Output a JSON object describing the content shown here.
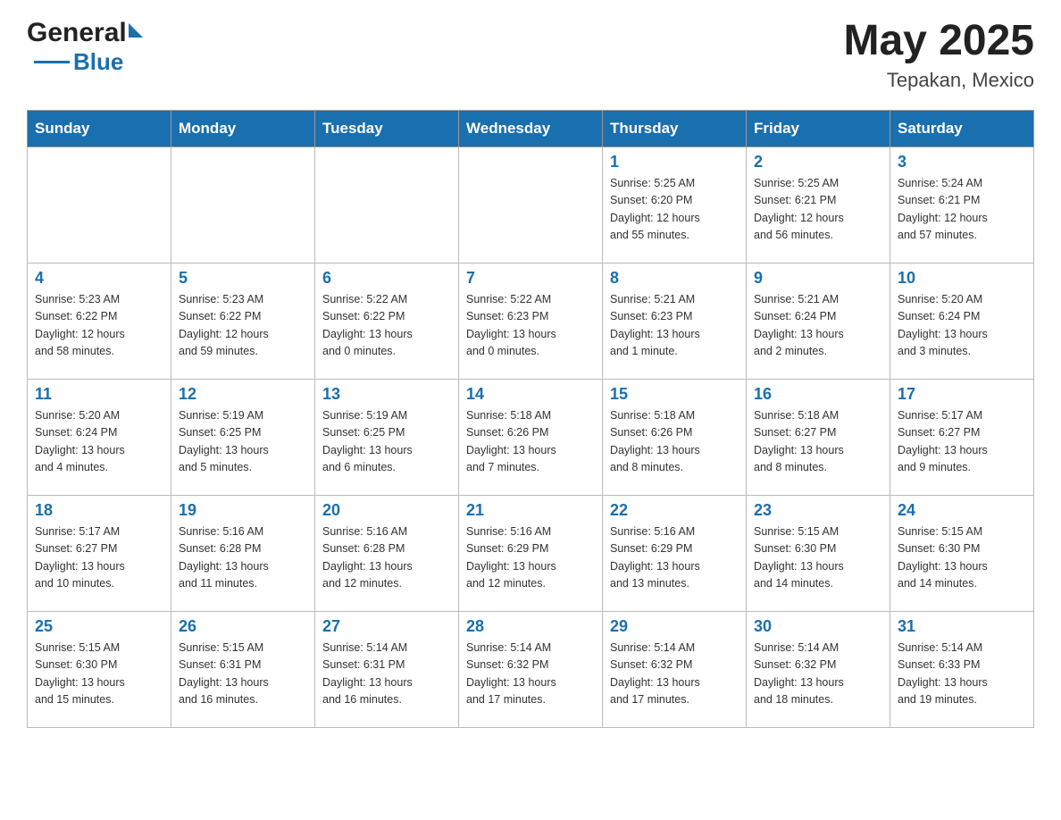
{
  "header": {
    "logo_general": "General",
    "logo_blue": "Blue",
    "month_year": "May 2025",
    "location": "Tepakan, Mexico"
  },
  "days_of_week": [
    "Sunday",
    "Monday",
    "Tuesday",
    "Wednesday",
    "Thursday",
    "Friday",
    "Saturday"
  ],
  "weeks": [
    [
      {
        "day": "",
        "info": ""
      },
      {
        "day": "",
        "info": ""
      },
      {
        "day": "",
        "info": ""
      },
      {
        "day": "",
        "info": ""
      },
      {
        "day": "1",
        "info": "Sunrise: 5:25 AM\nSunset: 6:20 PM\nDaylight: 12 hours\nand 55 minutes."
      },
      {
        "day": "2",
        "info": "Sunrise: 5:25 AM\nSunset: 6:21 PM\nDaylight: 12 hours\nand 56 minutes."
      },
      {
        "day": "3",
        "info": "Sunrise: 5:24 AM\nSunset: 6:21 PM\nDaylight: 12 hours\nand 57 minutes."
      }
    ],
    [
      {
        "day": "4",
        "info": "Sunrise: 5:23 AM\nSunset: 6:22 PM\nDaylight: 12 hours\nand 58 minutes."
      },
      {
        "day": "5",
        "info": "Sunrise: 5:23 AM\nSunset: 6:22 PM\nDaylight: 12 hours\nand 59 minutes."
      },
      {
        "day": "6",
        "info": "Sunrise: 5:22 AM\nSunset: 6:22 PM\nDaylight: 13 hours\nand 0 minutes."
      },
      {
        "day": "7",
        "info": "Sunrise: 5:22 AM\nSunset: 6:23 PM\nDaylight: 13 hours\nand 0 minutes."
      },
      {
        "day": "8",
        "info": "Sunrise: 5:21 AM\nSunset: 6:23 PM\nDaylight: 13 hours\nand 1 minute."
      },
      {
        "day": "9",
        "info": "Sunrise: 5:21 AM\nSunset: 6:24 PM\nDaylight: 13 hours\nand 2 minutes."
      },
      {
        "day": "10",
        "info": "Sunrise: 5:20 AM\nSunset: 6:24 PM\nDaylight: 13 hours\nand 3 minutes."
      }
    ],
    [
      {
        "day": "11",
        "info": "Sunrise: 5:20 AM\nSunset: 6:24 PM\nDaylight: 13 hours\nand 4 minutes."
      },
      {
        "day": "12",
        "info": "Sunrise: 5:19 AM\nSunset: 6:25 PM\nDaylight: 13 hours\nand 5 minutes."
      },
      {
        "day": "13",
        "info": "Sunrise: 5:19 AM\nSunset: 6:25 PM\nDaylight: 13 hours\nand 6 minutes."
      },
      {
        "day": "14",
        "info": "Sunrise: 5:18 AM\nSunset: 6:26 PM\nDaylight: 13 hours\nand 7 minutes."
      },
      {
        "day": "15",
        "info": "Sunrise: 5:18 AM\nSunset: 6:26 PM\nDaylight: 13 hours\nand 8 minutes."
      },
      {
        "day": "16",
        "info": "Sunrise: 5:18 AM\nSunset: 6:27 PM\nDaylight: 13 hours\nand 8 minutes."
      },
      {
        "day": "17",
        "info": "Sunrise: 5:17 AM\nSunset: 6:27 PM\nDaylight: 13 hours\nand 9 minutes."
      }
    ],
    [
      {
        "day": "18",
        "info": "Sunrise: 5:17 AM\nSunset: 6:27 PM\nDaylight: 13 hours\nand 10 minutes."
      },
      {
        "day": "19",
        "info": "Sunrise: 5:16 AM\nSunset: 6:28 PM\nDaylight: 13 hours\nand 11 minutes."
      },
      {
        "day": "20",
        "info": "Sunrise: 5:16 AM\nSunset: 6:28 PM\nDaylight: 13 hours\nand 12 minutes."
      },
      {
        "day": "21",
        "info": "Sunrise: 5:16 AM\nSunset: 6:29 PM\nDaylight: 13 hours\nand 12 minutes."
      },
      {
        "day": "22",
        "info": "Sunrise: 5:16 AM\nSunset: 6:29 PM\nDaylight: 13 hours\nand 13 minutes."
      },
      {
        "day": "23",
        "info": "Sunrise: 5:15 AM\nSunset: 6:30 PM\nDaylight: 13 hours\nand 14 minutes."
      },
      {
        "day": "24",
        "info": "Sunrise: 5:15 AM\nSunset: 6:30 PM\nDaylight: 13 hours\nand 14 minutes."
      }
    ],
    [
      {
        "day": "25",
        "info": "Sunrise: 5:15 AM\nSunset: 6:30 PM\nDaylight: 13 hours\nand 15 minutes."
      },
      {
        "day": "26",
        "info": "Sunrise: 5:15 AM\nSunset: 6:31 PM\nDaylight: 13 hours\nand 16 minutes."
      },
      {
        "day": "27",
        "info": "Sunrise: 5:14 AM\nSunset: 6:31 PM\nDaylight: 13 hours\nand 16 minutes."
      },
      {
        "day": "28",
        "info": "Sunrise: 5:14 AM\nSunset: 6:32 PM\nDaylight: 13 hours\nand 17 minutes."
      },
      {
        "day": "29",
        "info": "Sunrise: 5:14 AM\nSunset: 6:32 PM\nDaylight: 13 hours\nand 17 minutes."
      },
      {
        "day": "30",
        "info": "Sunrise: 5:14 AM\nSunset: 6:32 PM\nDaylight: 13 hours\nand 18 minutes."
      },
      {
        "day": "31",
        "info": "Sunrise: 5:14 AM\nSunset: 6:33 PM\nDaylight: 13 hours\nand 19 minutes."
      }
    ]
  ]
}
